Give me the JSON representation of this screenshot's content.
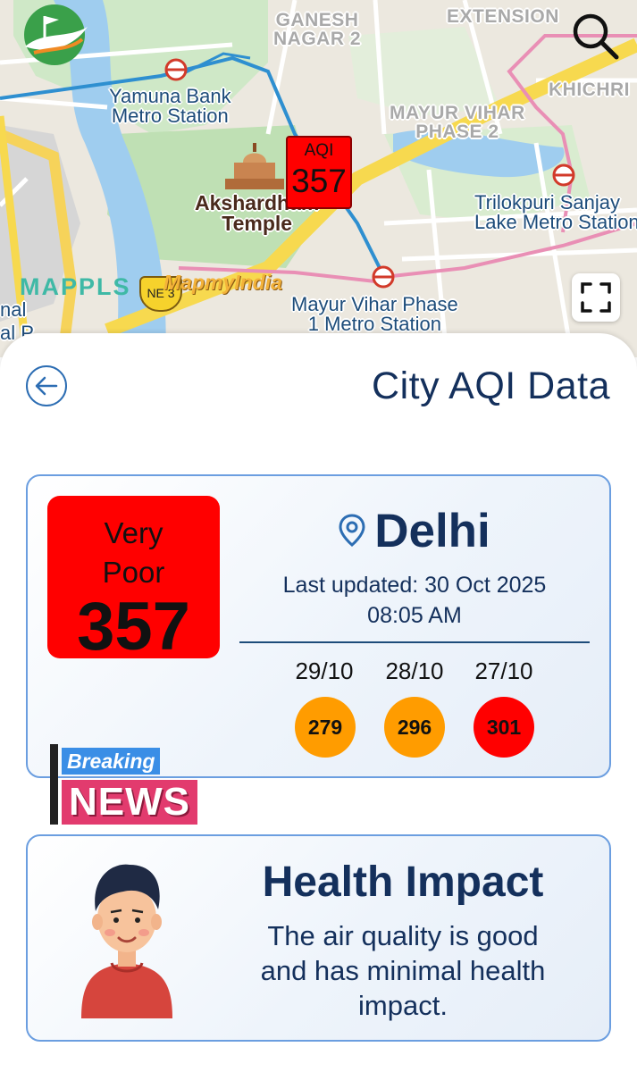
{
  "map": {
    "areas": [
      "GANESH\nNAGAR 2",
      "EXTENSION",
      "KHICHRI",
      "MAYUR VIHAR\nPHASE 2"
    ],
    "stations": {
      "yamuna": "Yamuna Bank\nMetro Station",
      "trilokpuri": "Trilokpuri Sanjay\nLake Metro Station",
      "mayur": "Mayur Vihar Phase\n1 Metro Station"
    },
    "temple": "Akshardham\nTemple",
    "marker": {
      "label": "AQI",
      "value": "357"
    },
    "attribution": {
      "mappls": "MAPPLS",
      "mapmyindia": "MapmyIndia",
      "road_badge": "NE 3"
    },
    "edge_labels": [
      "nal",
      "al P"
    ]
  },
  "header": {
    "title": "City AQI Data"
  },
  "aqi": {
    "category": "Very\nPoor",
    "value": "357",
    "city": "Delhi",
    "updated": "Last updated: 30 Oct 2025\n08:05 AM",
    "history": [
      {
        "date": "29/10",
        "value": "279",
        "color": "#ff9c00"
      },
      {
        "date": "28/10",
        "value": "296",
        "color": "#ff9c00"
      },
      {
        "date": "27/10",
        "value": "301",
        "color": "#ff0000"
      }
    ]
  },
  "breaking": {
    "top": "Breaking",
    "bottom": "NEWS"
  },
  "health": {
    "title": "Health Impact",
    "text": "The air quality is good\nand has minimal health\nimpact."
  },
  "icons": {
    "logo": "leaf-flag-logo-icon",
    "search": "search-icon",
    "expand": "expand-icon",
    "back": "back-arrow-icon",
    "location": "location-pin-icon",
    "metro": "metro-station-icon",
    "temple": "temple-icon"
  },
  "colors": {
    "aqi_very_poor": "#ff0000",
    "aqi_poor": "#ff9c00",
    "primary_text": "#14305c",
    "accent_border": "#6b9ee0"
  }
}
